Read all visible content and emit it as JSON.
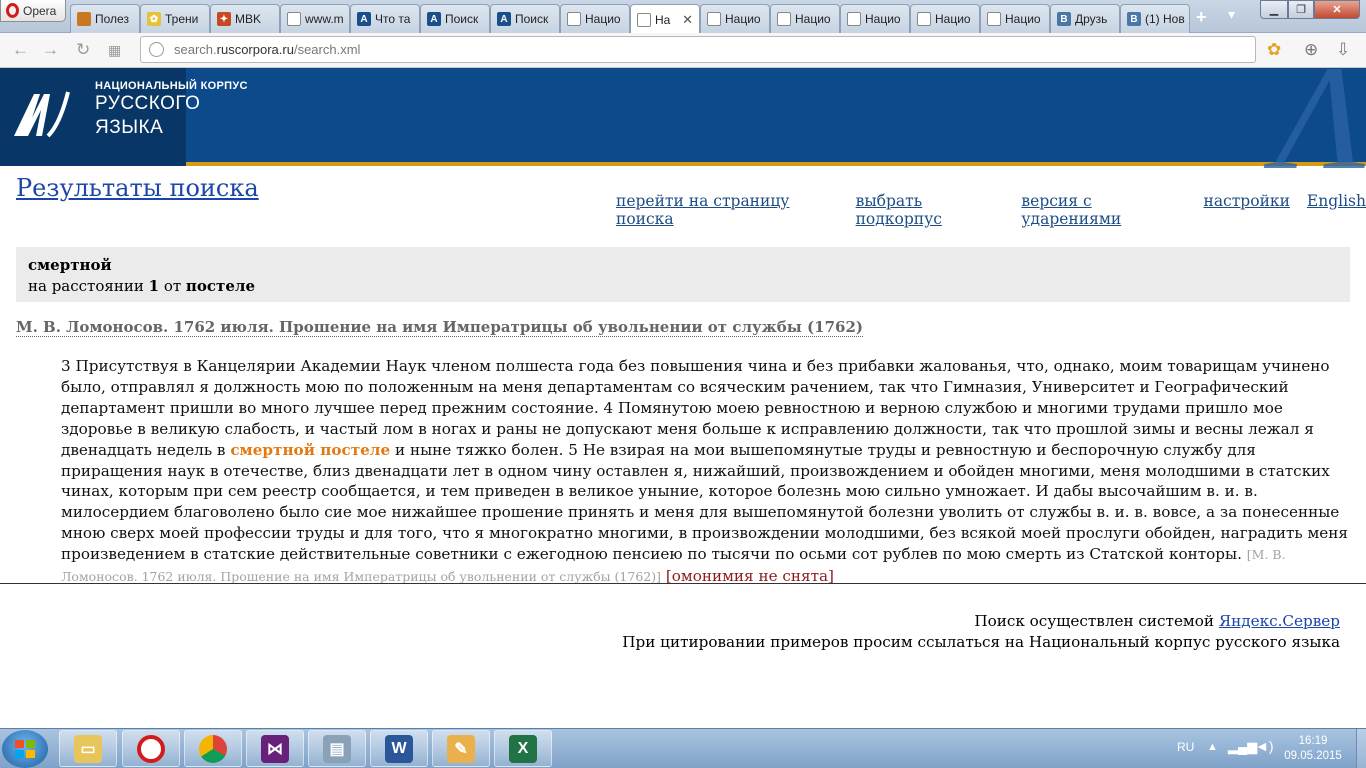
{
  "browser": {
    "menu_label": "Opera",
    "tabs": [
      {
        "title": "Полез",
        "fav_color": "#c8781e",
        "fav_char": ""
      },
      {
        "title": "Трени",
        "fav_color": "#e6c23a",
        "fav_char": "✿"
      },
      {
        "title": "MBK",
        "fav_color": "#c84820",
        "fav_char": "✦"
      },
      {
        "title": "www.m",
        "fav_color": "#ffffff",
        "fav_char": ""
      },
      {
        "title": "Что та",
        "fav_color": "#1b4f8c",
        "fav_char": "A"
      },
      {
        "title": "Поиск",
        "fav_color": "#1b4f8c",
        "fav_char": "A"
      },
      {
        "title": "Поиск",
        "fav_color": "#1b4f8c",
        "fav_char": "A"
      },
      {
        "title": "Нацио",
        "fav_color": "#ffffff",
        "fav_char": ""
      },
      {
        "title": "На",
        "fav_color": "#ffffff",
        "fav_char": "",
        "active": true
      },
      {
        "title": "Нацио",
        "fav_color": "#ffffff",
        "fav_char": ""
      },
      {
        "title": "Нацио",
        "fav_color": "#ffffff",
        "fav_char": ""
      },
      {
        "title": "Нацио",
        "fav_color": "#ffffff",
        "fav_char": ""
      },
      {
        "title": "Нацио",
        "fav_color": "#ffffff",
        "fav_char": ""
      },
      {
        "title": "Нацио",
        "fav_color": "#ffffff",
        "fav_char": ""
      },
      {
        "title": "Друзь",
        "fav_color": "#4a76a8",
        "fav_char": "B"
      },
      {
        "title": "(1) Нов",
        "fav_color": "#4a76a8",
        "fav_char": "B"
      }
    ],
    "url_prefix": "search.",
    "url_domain": "ruscorpora.ru",
    "url_path": "/search.xml"
  },
  "site": {
    "logo_line1": "НАЦИОНАЛЬНЫЙ КОРПУС",
    "logo_line2": "РУССКОГО",
    "logo_line3": "ЯЗЫКА",
    "brand_color": "#0c4a8c",
    "accent_color": "#d69a14"
  },
  "page": {
    "title": "Результаты поиска",
    "links": [
      "перейти на страницу поиска",
      "выбрать подкорпус",
      "версия с ударениями",
      "настройки",
      "English"
    ]
  },
  "query": {
    "word1": "смертной",
    "distance_prefix": "на расстоянии ",
    "distance_value": "1",
    "distance_middle": " от ",
    "word2": "постеле"
  },
  "result": {
    "doc_title": "М. В. Ломоносов. 1762 июля. Прошение на имя Императрицы об увольнении от службы (1762)",
    "text_before": "3 Присутствуя в Канцелярии Академии Наук членом полшеста года без повышения чина и без прибавки жалованья, что, однако, моим товарищам учинено было, отправлял я должность мою по положенным на меня департаментам со всяческим рачением, так что Гимназия, Университет и Географический департамент пришли во много лучшее перед прежним состояние. 4 Помянутою моею ревностною и верною службою и многими трудами пришло мое здоровье в великую слабость, и частый лом в ногах и раны не допускают меня больше к исправлению должности, так что прошлой зимы и весны лежал я двенадцать недель в ",
    "hit": "смертной постеле",
    "text_after": " и ныне тяжко болен. 5 Не взирая на мои вышепомянутые труды и ревностную и беспорочную службу для приращения наук в отечестве, близ двенадцати лет в одном чину оставлен я, нижайший, произвождением и обойден многими, меня молодшими в статских чинах, которым при сем реестр сообщается, и тем приведен в великое уныние, которое болезнь мою сильно умножает. И дабы высочайшим в. и. в. милосердием благоволено было сие мое нижайшее прошение принять и меня для вышепомянутой болезни уволить от службы в. и. в. вовсе, а за понесенные мною сверх моей профессии труды и для того, что я многократно многими, в произвождении молодшими, без всякой моей прослуги обойден, наградить меня произведением в статские действительные советники с ежегодною пенсиею по тысячи по осьми сот рублев по мою смерть из Статской конторы. ",
    "source": "[М. В. Ломоносов. 1762 июля. Прошение на имя Императрицы об увольнении от службы (1762)]",
    "homonymy": "[омонимия не снята]"
  },
  "footer": {
    "line1_text": "Поиск осуществлен системой ",
    "line1_link": "Яндекс.Сервер",
    "line2": "При цитировании примеров просим ссылаться на Национальный корпус русского языка"
  },
  "taskbar": {
    "apps": [
      "explorer-icon",
      "opera-icon",
      "chrome-icon",
      "visual-studio-icon",
      "calculator-icon",
      "word-icon",
      "paint-icon",
      "excel-icon"
    ],
    "lang": "RU",
    "time": "16:19",
    "date": "09.05.2015"
  }
}
